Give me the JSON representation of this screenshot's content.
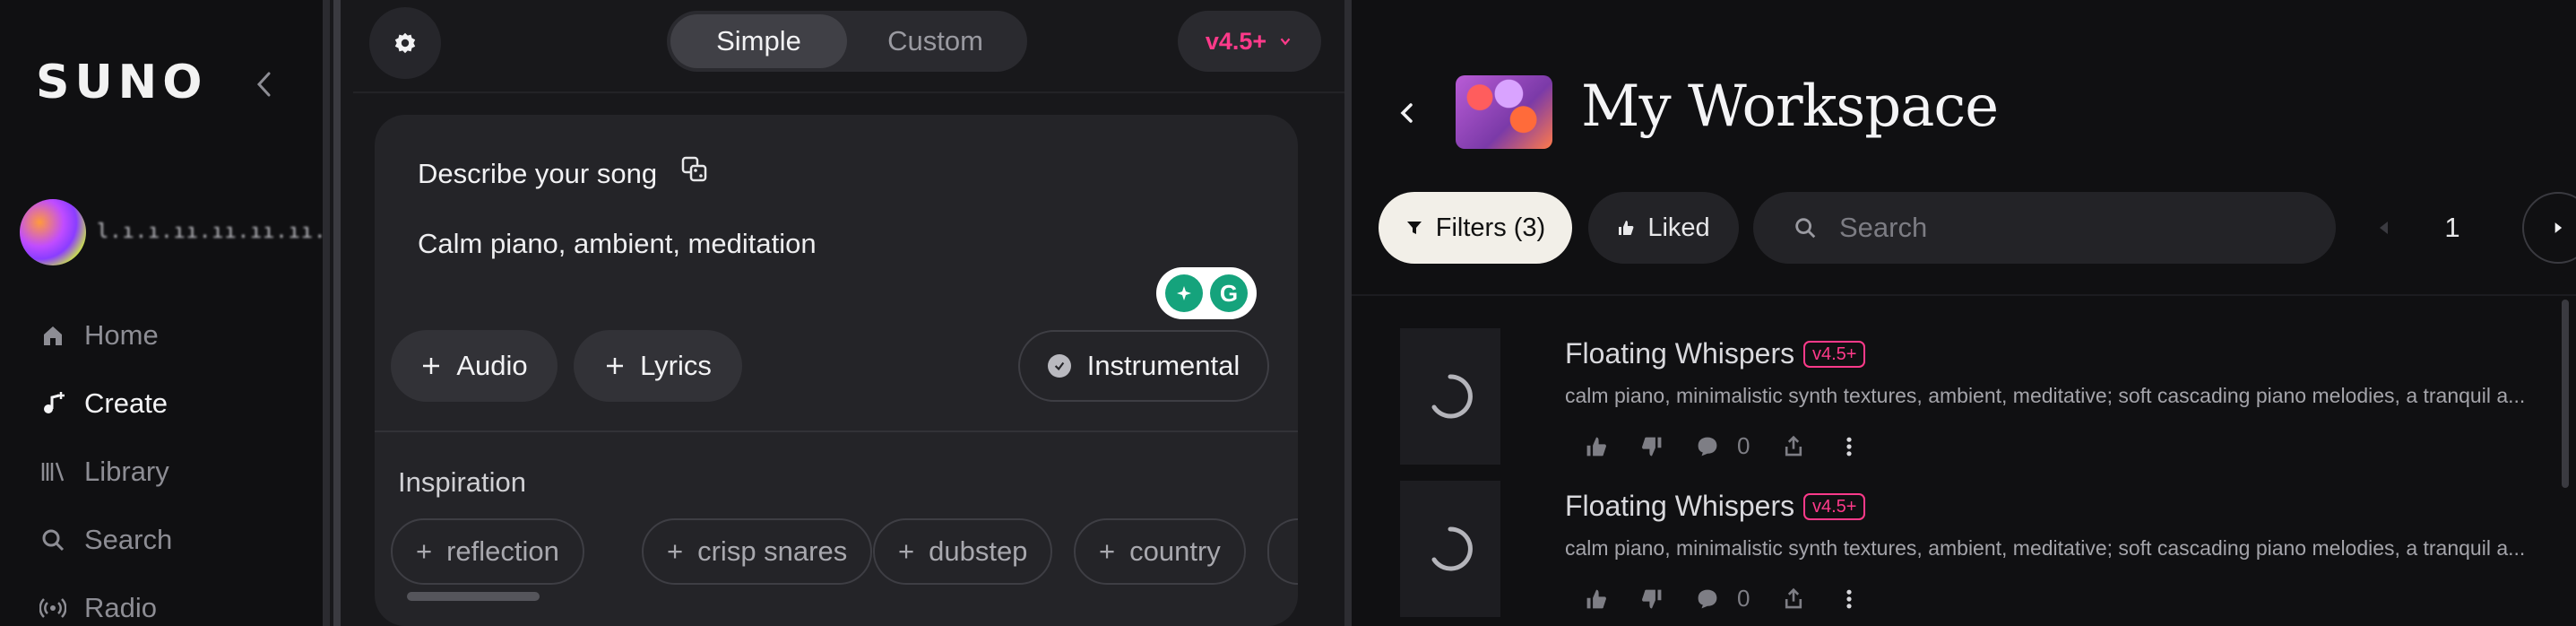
{
  "sidebar": {
    "logo": "SUNO",
    "username": "l.ı.ı.ıı.ıı.ıı.ıı.",
    "nav": [
      {
        "label": "Home",
        "icon": "home-icon"
      },
      {
        "label": "Create",
        "icon": "create-icon",
        "active": true
      },
      {
        "label": "Library",
        "icon": "library-icon"
      },
      {
        "label": "Search",
        "icon": "search-icon"
      },
      {
        "label": "Radio",
        "icon": "radio-icon"
      }
    ]
  },
  "create": {
    "modes": [
      "Simple",
      "Custom"
    ],
    "active_mode": "Simple",
    "version": "v4.5+",
    "describe_label": "Describe your song",
    "prompt": "Calm piano, ambient, meditation",
    "buttons": {
      "audio": "Audio",
      "lyrics": "Lyrics",
      "instrumental": "Instrumental"
    },
    "inspiration_label": "Inspiration",
    "tags": [
      "reflection",
      "crisp snares",
      "dubstep",
      "country"
    ]
  },
  "workspace": {
    "title": "My Workspace",
    "filters": "Filters (3)",
    "liked": "Liked",
    "search_placeholder": "Search",
    "page": "1",
    "songs": [
      {
        "title": "Floating Whispers",
        "version": "v4.5+",
        "description": "calm piano, minimalistic synth textures, ambient, meditative; soft cascading piano melodies, a tranquil a...",
        "comments": "0"
      },
      {
        "title": "Floating Whispers",
        "version": "v4.5+",
        "description": "calm piano, minimalistic synth textures, ambient, meditative; soft cascading piano melodies, a tranquil a...",
        "comments": "0"
      }
    ]
  },
  "colors": {
    "accent": "#ff3a8a",
    "filters_bg": "#f2efe8"
  }
}
